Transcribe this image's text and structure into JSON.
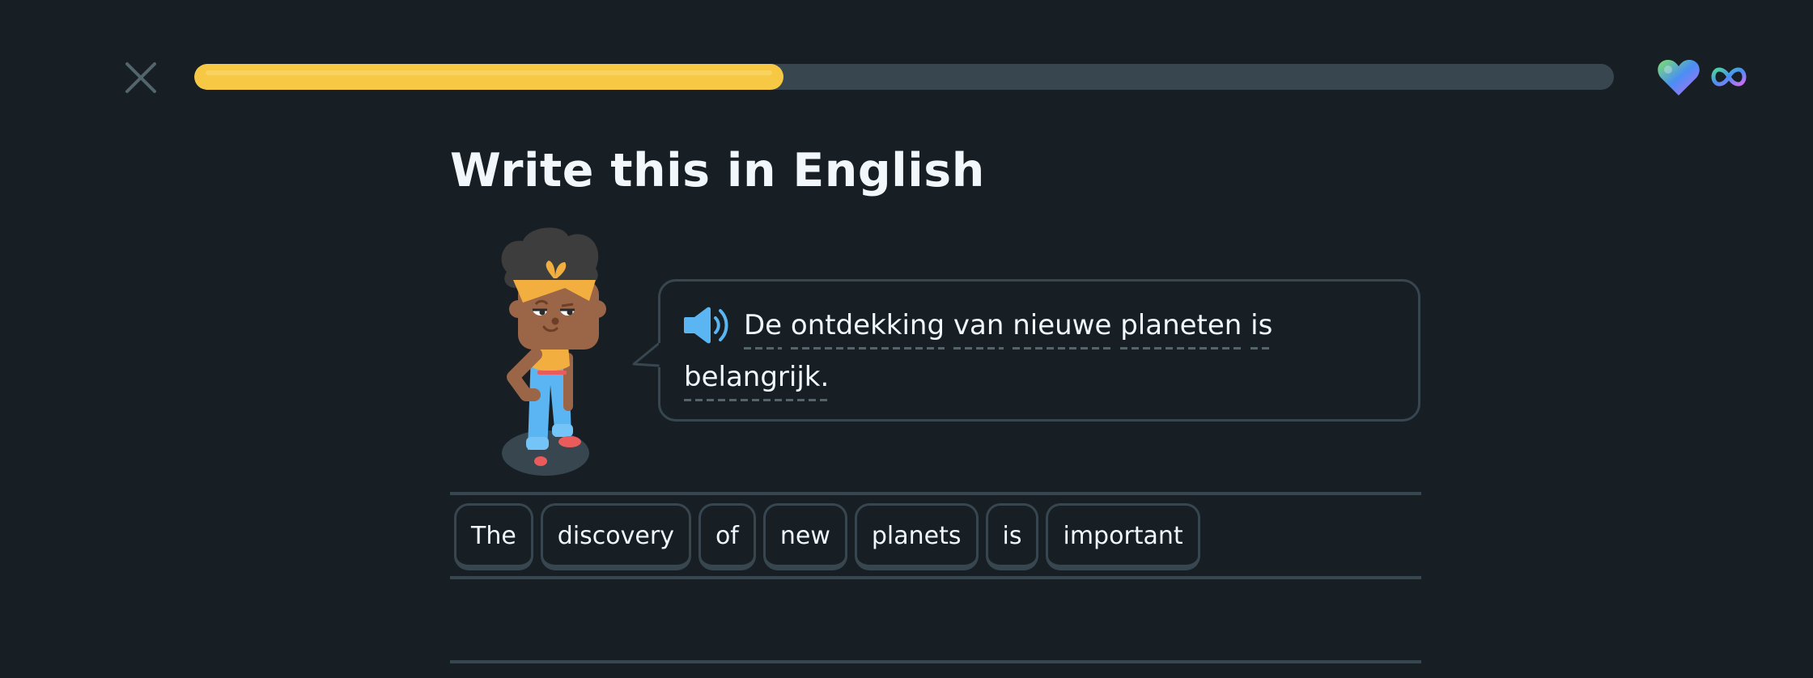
{
  "header": {
    "close_icon": "close-icon",
    "progress": 0.415,
    "hearts_icon": "heart-icon",
    "hearts_value_icon": "infinity-icon",
    "colors": {
      "progress_fill": "#f7c843",
      "progress_track": "#37464f",
      "background": "#171e24"
    }
  },
  "challenge": {
    "title": "Write this in English",
    "speaker_icon": "speaker-icon",
    "prompt_tokens": [
      {
        "text": "De"
      },
      {
        "text": "ontdekking"
      },
      {
        "text": "van"
      },
      {
        "text": "nieuwe"
      },
      {
        "text": "planeten"
      },
      {
        "text": "is"
      },
      {
        "text": "belangrijk."
      }
    ]
  },
  "answer": {
    "selected_words": [],
    "word_bank": [
      "The",
      "discovery",
      "of",
      "new",
      "planets",
      "is",
      "important"
    ]
  }
}
